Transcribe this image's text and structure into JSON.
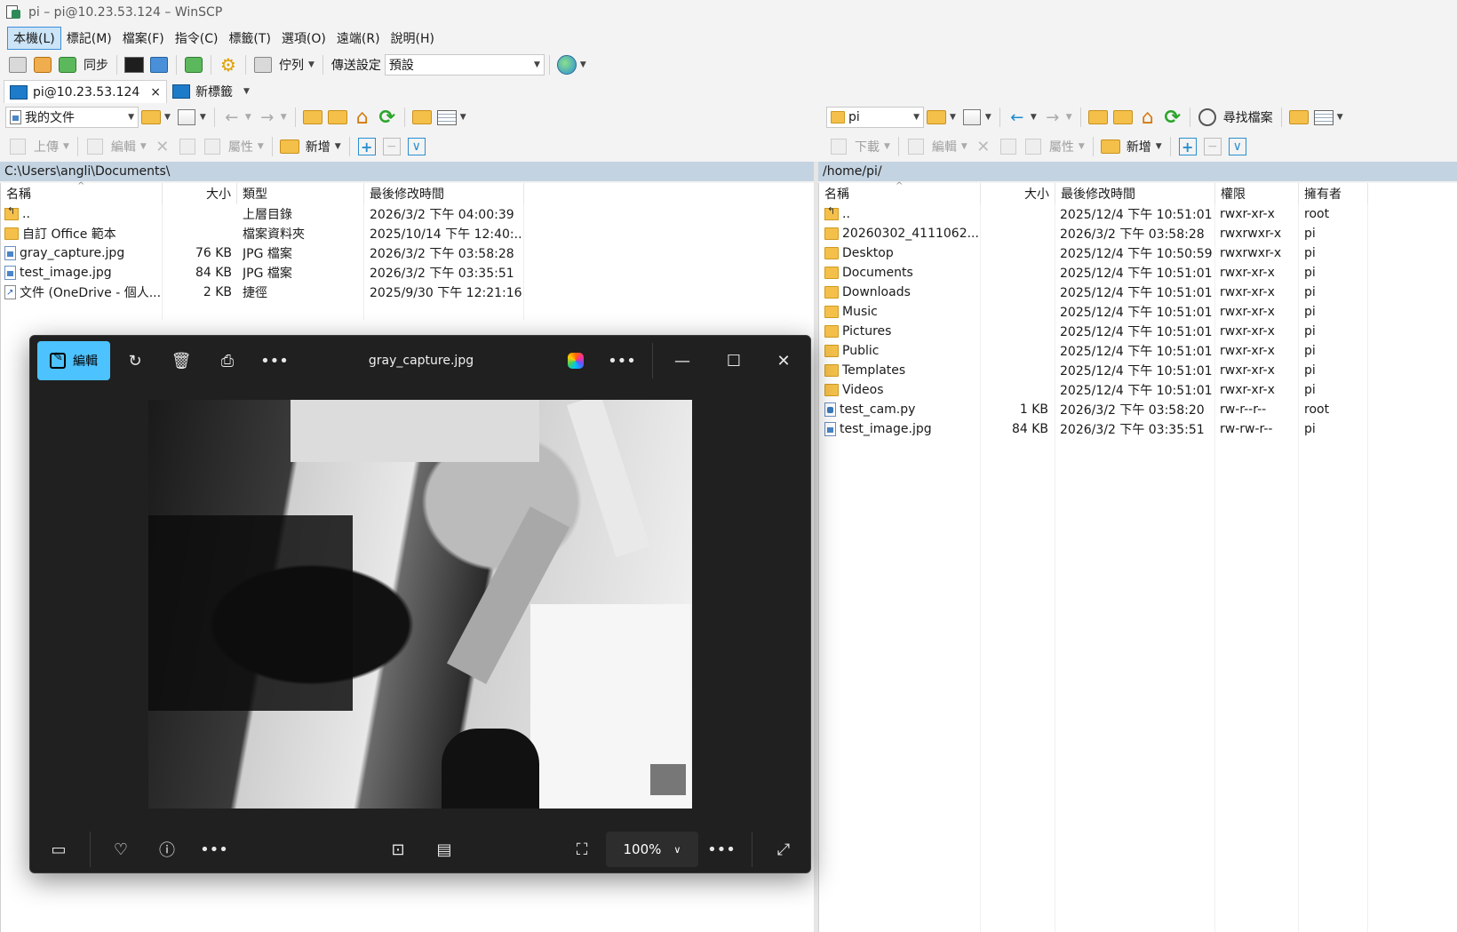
{
  "window": {
    "title": "pi – pi@10.23.53.124 – WinSCP"
  },
  "menu": [
    "本機(L)",
    "標記(M)",
    "檔案(F)",
    "指令(C)",
    "標籤(T)",
    "選項(O)",
    "遠端(R)",
    "說明(H)"
  ],
  "toolbar": {
    "sync_label": "同步",
    "queue_label": "佇列",
    "transfer_label": "傳送設定",
    "transfer_value": "預設"
  },
  "tabs": [
    {
      "label": "pi@10.23.53.124",
      "close": "×"
    },
    {
      "label": "新標籤"
    }
  ],
  "local": {
    "location": "我的文件",
    "upload_label": "上傳",
    "edit_label": "編輯",
    "props_label": "屬性",
    "new_label": "新增",
    "path": "C:\\Users\\angli\\Documents\\",
    "columns": [
      "名稱",
      "大小",
      "類型",
      "最後修改時間"
    ],
    "files": [
      {
        "icon": "up",
        "name": "..",
        "size": "",
        "type": "上層目錄",
        "modified": "2026/3/2 下午 04:00:39"
      },
      {
        "icon": "folder",
        "name": "自訂 Office 範本",
        "size": "",
        "type": "檔案資料夾",
        "modified": "2025/10/14 下午 12:40:..."
      },
      {
        "icon": "file",
        "name": "gray_capture.jpg",
        "size": "76 KB",
        "type": "JPG 檔案",
        "modified": "2026/3/2 下午 03:58:28"
      },
      {
        "icon": "file",
        "name": "test_image.jpg",
        "size": "84 KB",
        "type": "JPG 檔案",
        "modified": "2026/3/2 下午 03:35:51"
      },
      {
        "icon": "shortcut",
        "name": "文件 (OneDrive - 個人...",
        "size": "2 KB",
        "type": "捷徑",
        "modified": "2025/9/30 下午 12:21:16"
      }
    ]
  },
  "remote": {
    "location": "pi",
    "download_label": "下載",
    "edit_label": "編輯",
    "props_label": "屬性",
    "new_label": "新增",
    "find_label": "尋找檔案",
    "path": "/home/pi/",
    "columns": [
      "名稱",
      "大小",
      "最後修改時間",
      "權限",
      "擁有者"
    ],
    "files": [
      {
        "icon": "up",
        "name": "..",
        "size": "",
        "modified": "2025/12/4 下午 10:51:01",
        "rights": "rwxr-xr-x",
        "owner": "root"
      },
      {
        "icon": "folder",
        "name": "20260302_4111062...",
        "size": "",
        "modified": "2026/3/2 下午 03:58:28",
        "rights": "rwxrwxr-x",
        "owner": "pi"
      },
      {
        "icon": "folder",
        "name": "Desktop",
        "size": "",
        "modified": "2025/12/4 下午 10:50:59",
        "rights": "rwxrwxr-x",
        "owner": "pi"
      },
      {
        "icon": "folder",
        "name": "Documents",
        "size": "",
        "modified": "2025/12/4 下午 10:51:01",
        "rights": "rwxr-xr-x",
        "owner": "pi"
      },
      {
        "icon": "folder",
        "name": "Downloads",
        "size": "",
        "modified": "2025/12/4 下午 10:51:01",
        "rights": "rwxr-xr-x",
        "owner": "pi"
      },
      {
        "icon": "folder",
        "name": "Music",
        "size": "",
        "modified": "2025/12/4 下午 10:51:01",
        "rights": "rwxr-xr-x",
        "owner": "pi"
      },
      {
        "icon": "folder",
        "name": "Pictures",
        "size": "",
        "modified": "2025/12/4 下午 10:51:01",
        "rights": "rwxr-xr-x",
        "owner": "pi"
      },
      {
        "icon": "folder",
        "name": "Public",
        "size": "",
        "modified": "2025/12/4 下午 10:51:01",
        "rights": "rwxr-xr-x",
        "owner": "pi"
      },
      {
        "icon": "folder",
        "name": "Templates",
        "size": "",
        "modified": "2025/12/4 下午 10:51:01",
        "rights": "rwxr-xr-x",
        "owner": "pi"
      },
      {
        "icon": "folder",
        "name": "Videos",
        "size": "",
        "modified": "2025/12/4 下午 10:51:01",
        "rights": "rwxr-xr-x",
        "owner": "pi"
      },
      {
        "icon": "py",
        "name": "test_cam.py",
        "size": "1 KB",
        "modified": "2026/3/2 下午 03:58:20",
        "rights": "rw-r--r--",
        "owner": "root"
      },
      {
        "icon": "file",
        "name": "test_image.jpg",
        "size": "84 KB",
        "modified": "2026/3/2 下午 03:35:51",
        "rights": "rw-rw-r--",
        "owner": "pi"
      }
    ]
  },
  "viewer": {
    "edit_label": "編輯",
    "file_name": "gray_capture.jpg",
    "zoom": "100%",
    "accent": "#4cc2ff"
  }
}
